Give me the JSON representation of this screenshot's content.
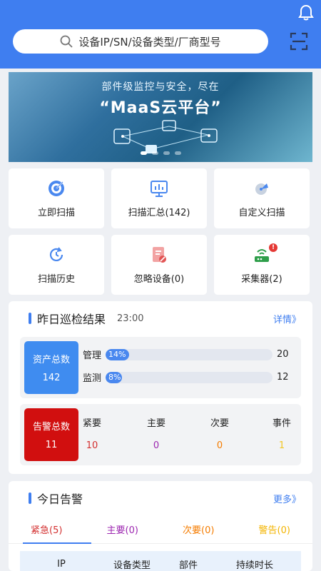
{
  "header": {
    "search_placeholder": "设备IP/SN/设备类型/厂商型号"
  },
  "banner": {
    "subtitle": "部件级监控与安全，尽在",
    "title": "“MaaS云平台”"
  },
  "quick_actions": [
    {
      "label": "立即扫描",
      "icon": "target-icon"
    },
    {
      "label": "扫描汇总(142)",
      "icon": "monitor-chart-icon"
    },
    {
      "label": "自定义扫描",
      "icon": "radar-icon"
    },
    {
      "label": "扫描历史",
      "icon": "history-clock-icon"
    },
    {
      "label": "忽略设备(0)",
      "icon": "ignore-document-icon"
    },
    {
      "label": "采集器(2)",
      "icon": "router-collector-icon",
      "badge": "!"
    }
  ],
  "inspection": {
    "title": "昨日巡检结果",
    "time": "23:00",
    "more": "详情》",
    "assets": {
      "label": "资产总数",
      "total": "142",
      "color": "#3f8cf0",
      "rows": [
        {
          "label": "管理",
          "percent_text": "14%",
          "percent": 14,
          "count": "20"
        },
        {
          "label": "监测",
          "percent_text": "8%",
          "percent": 8,
          "count": "12"
        }
      ]
    },
    "alarms": {
      "label": "告警总数",
      "total": "11",
      "color": "#d10f0f",
      "levels": [
        {
          "label": "紧要",
          "value": "10",
          "color": "#d32f2f"
        },
        {
          "label": "主要",
          "value": "0",
          "color": "#9c27b0"
        },
        {
          "label": "次要",
          "value": "0",
          "color": "#f57c00"
        },
        {
          "label": "事件",
          "value": "1",
          "color": "#f3c623"
        }
      ]
    }
  },
  "today_alarms": {
    "title": "今日告警",
    "more": "更多》",
    "tabs": [
      {
        "label": "紧急(5)",
        "color": "#d32f2f"
      },
      {
        "label": "主要(0)",
        "color": "#9c27b0"
      },
      {
        "label": "次要(0)",
        "color": "#f57c00"
      },
      {
        "label": "警告(0)",
        "color": "#f3b400"
      }
    ],
    "columns": [
      "IP",
      "设备类型",
      "部件",
      "持续时长"
    ]
  }
}
